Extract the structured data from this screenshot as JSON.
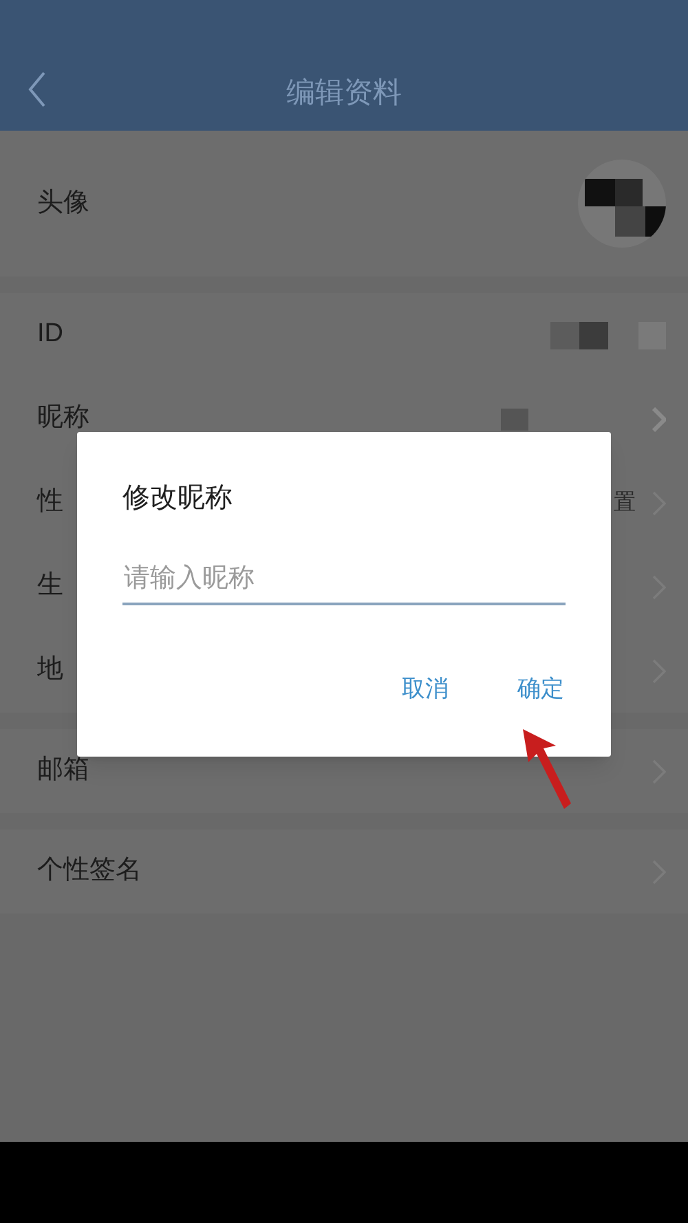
{
  "header": {
    "title": "编辑资料"
  },
  "groups": [
    [
      {
        "label": "头像",
        "kind": "avatar"
      }
    ],
    [
      {
        "label": "ID",
        "kind": "blurred",
        "chevron": false
      },
      {
        "label": "昵称",
        "kind": "blurred",
        "chevron": true
      },
      {
        "label": "性",
        "kind": "link",
        "value": "置"
      },
      {
        "label": "生",
        "kind": "link"
      },
      {
        "label": "地",
        "kind": "link"
      }
    ],
    [
      {
        "label": "邮箱",
        "kind": "link"
      }
    ],
    [
      {
        "label": "个性签名",
        "kind": "link"
      }
    ]
  ],
  "dialog": {
    "title": "修改昵称",
    "input": {
      "placeholder": "请输入昵称"
    },
    "buttons": [
      "取消",
      "确定"
    ]
  }
}
